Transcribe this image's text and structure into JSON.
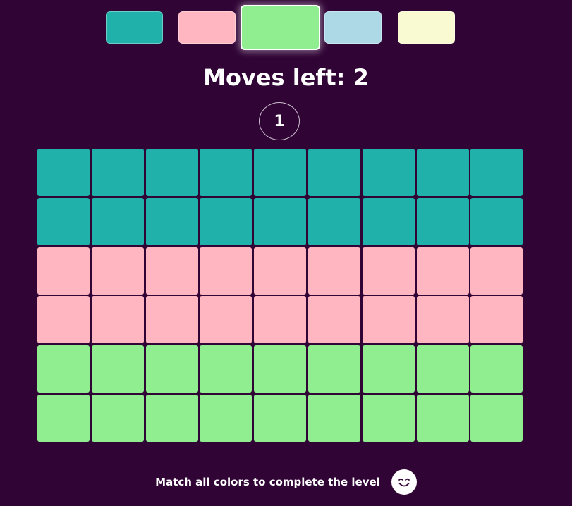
{
  "palette": {
    "colors": [
      {
        "name": "teal",
        "hex": "#20b2aa"
      },
      {
        "name": "pink",
        "hex": "#ffb6c1"
      },
      {
        "name": "green",
        "hex": "#90ee90"
      },
      {
        "name": "light-blue",
        "hex": "#add8e6"
      },
      {
        "name": "light-yellow",
        "hex": "#fafad2"
      }
    ],
    "selected_index": 2
  },
  "moves": {
    "text": "Moves left: 2",
    "count": 2
  },
  "level": {
    "number": "1"
  },
  "board": {
    "columns": 9,
    "rows": 6,
    "row_colors": [
      "#20b2aa",
      "#20b2aa",
      "#ffb6c1",
      "#ffb6c1",
      "#90ee90",
      "#90ee90"
    ]
  },
  "footer": {
    "message": "Match all colors to complete the level",
    "icon": "smiley-icon"
  },
  "theme": {
    "background": "#310436",
    "text": "#ffffff"
  }
}
